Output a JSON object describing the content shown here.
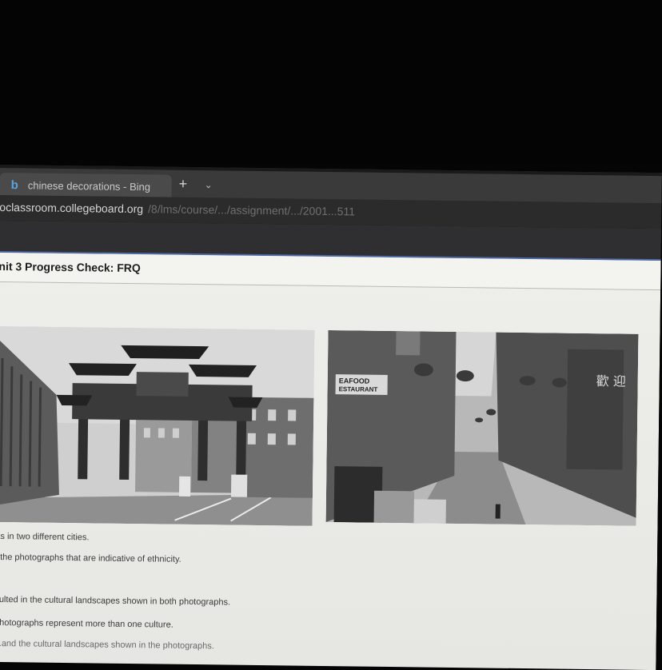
{
  "browser": {
    "tab_title": "chinese decorations - Bing",
    "tab_icon_glyph": "b",
    "new_tab_glyph": "+",
    "tab_menu_glyph": "⌄",
    "url_host": "oclassroom.collegeboard.org",
    "url_path": "/8/lms/course/.../assignment/.../2001...511"
  },
  "page": {
    "title": "nit 3 Progress Check: FRQ"
  },
  "photos": {
    "left": {
      "signs": []
    },
    "right": {
      "sign1": "EAFOOD",
      "sign2": "ESTAURANT",
      "vertical_sign": "歡 迎"
    }
  },
  "questions": [
    "as in two different cities.",
    "f the photographs that are indicative of ethnicity.",
    "sulted in the cultural landscapes shown in both photographs.",
    "photographs represent more than one culture.",
    "...and the cultural landscapes shown in the photographs."
  ],
  "colors": {
    "tabbar": "#3a3a3a",
    "accent": "#4d6aa6",
    "tab_icon": "#5aa5e0"
  }
}
